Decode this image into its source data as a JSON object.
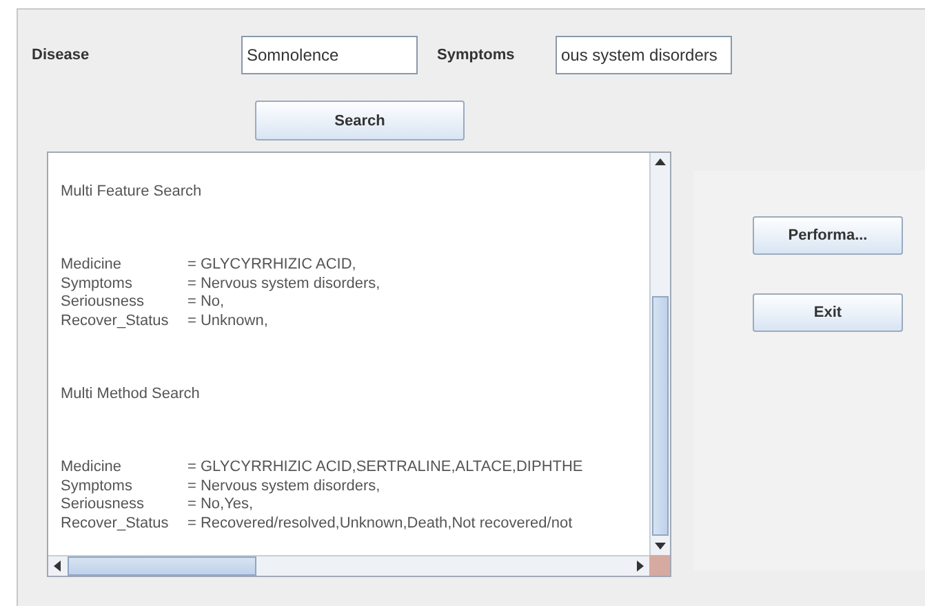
{
  "search_form": {
    "disease_label": "Disease",
    "disease_value": "Somnolence",
    "symptoms_label": "Symptoms",
    "symptoms_value": "ous system disorders",
    "search_button": "Search"
  },
  "results": [
    {
      "title": "Multi Feature Search",
      "fields": [
        {
          "label": "Medicine",
          "value": "= GLYCYRRHIZIC ACID,"
        },
        {
          "label": "Symptoms",
          "value": "= Nervous system disorders,"
        },
        {
          "label": "Seriousness",
          "value": "= No,"
        },
        {
          "label": "Recover_Status",
          "value": "= Unknown,"
        }
      ]
    },
    {
      "title": "Multi Method Search",
      "fields": [
        {
          "label": "Medicine",
          "value": "= GLYCYRRHIZIC ACID,SERTRALINE,ALTACE,DIPHTHE"
        },
        {
          "label": "Symptoms",
          "value": "= Nervous system disorders,"
        },
        {
          "label": "Seriousness",
          "value": "= No,Yes,"
        },
        {
          "label": "Recover_Status",
          "value": "= Recovered/resolved,Unknown,Death,Not recovered/not"
        }
      ]
    }
  ],
  "side_buttons": [
    "Performa...",
    "Exit"
  ]
}
